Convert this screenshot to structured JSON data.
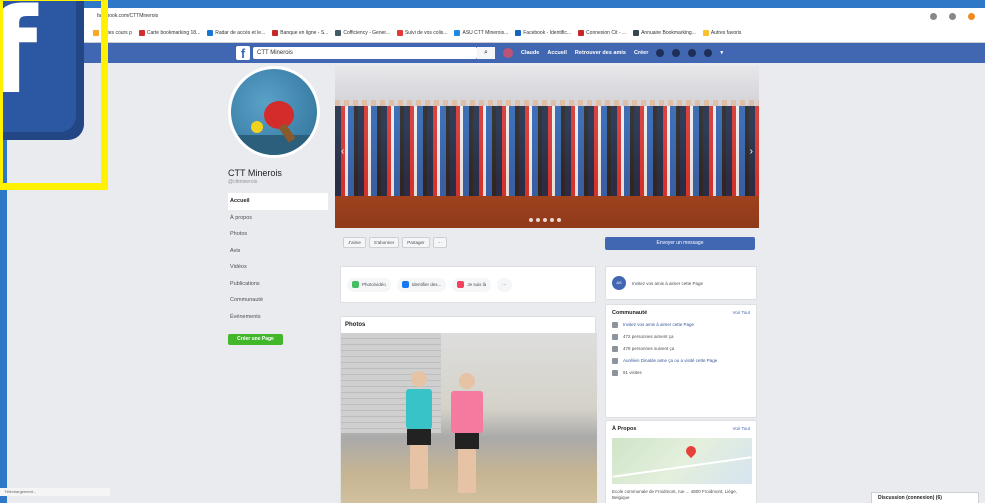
{
  "browser": {
    "url": "facebook.com/CTTMinerois",
    "bookmarks": [
      "Notes cours p",
      "Carte bookmarking 18...",
      "Radar de accès et le...",
      "Banque en ligne - S...",
      "Cofficiency - Gener...",
      "Suivi de vos colis...",
      "ASU CTT Minerois...",
      "Facebook - Identific...",
      "Connexion Cit - ...",
      "Annuaire Bookmarking...",
      "Autres favoris"
    ]
  },
  "fb_header": {
    "logo": "f",
    "search_value": "CTT Minerois",
    "search_icon": "search-icon",
    "user_name": "Claude",
    "nav": [
      "Accueil",
      "Retrouver des amis",
      "Créer"
    ]
  },
  "page": {
    "name": "CTT Minerois",
    "handle": "@cttminerois",
    "nav": [
      "Accueil",
      "À propos",
      "Photos",
      "Avis",
      "Vidéos",
      "Publications",
      "Communauté",
      "Événements"
    ],
    "create_page_label": "Créer une Page"
  },
  "actions": {
    "like": "J'aime",
    "follow": "S'abonner",
    "share": "Partager",
    "more": "···",
    "send_message": "Envoyer un message"
  },
  "post_bar": {
    "photo_video": "Photo/vidéo",
    "tag": "Identifier des...",
    "checkin": "Je suis là",
    "more": "···"
  },
  "photos": {
    "title": "Photos"
  },
  "invite": {
    "count": "AS",
    "text": "Invitez vos amis à aimer cette Page"
  },
  "community": {
    "title": "Communauté",
    "see_all": "Voir Tout",
    "items": [
      "Invitez vos amis à aimer cette Page",
      "472 personnes aiment ça",
      "478 personnes suivent ça",
      "Aurélien Dinalde aime ça ou a visité cette Page",
      "91 visites"
    ]
  },
  "about": {
    "title": "À Propos",
    "see_all": "Voir Tout",
    "address": "Ecole communale de Froidmont, rue ... 4800 Froidmont, Liège, Belgique"
  },
  "chat": {
    "label": "Discussion (connexion) (6)"
  },
  "status_bar": "Téléchargement..."
}
